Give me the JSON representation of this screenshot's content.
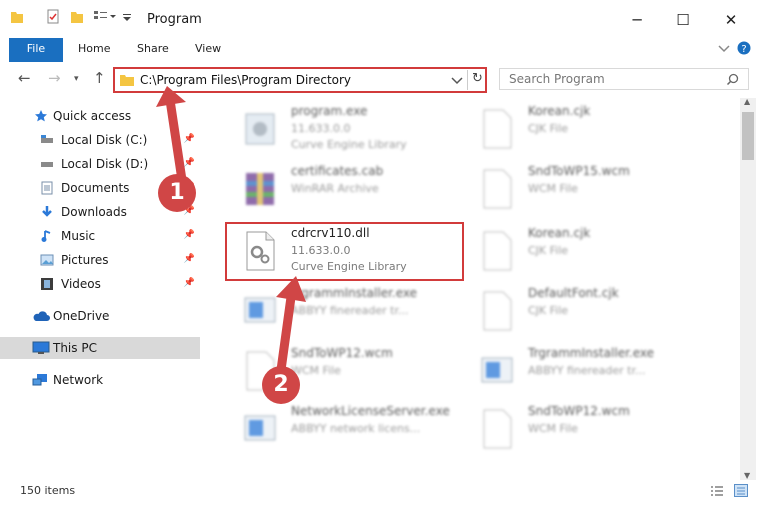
{
  "window": {
    "title": "Program"
  },
  "ribbon": {
    "tabs": [
      "File",
      "Home",
      "Share",
      "View"
    ]
  },
  "address": {
    "path": "C:\\Program Files\\Program Directory"
  },
  "search": {
    "placeholder": "Search Program"
  },
  "nav": {
    "items": [
      {
        "label": "Quick access",
        "icon": "star-icon",
        "pinned": false
      },
      {
        "label": "Local Disk (C:)",
        "icon": "drive-icon",
        "pinned": true
      },
      {
        "label": "Local Disk (D:)",
        "icon": "drive-icon",
        "pinned": true
      },
      {
        "label": "Documents",
        "icon": "document-icon",
        "pinned": true
      },
      {
        "label": "Downloads",
        "icon": "download-icon",
        "pinned": true
      },
      {
        "label": "Music",
        "icon": "music-icon",
        "pinned": true
      },
      {
        "label": "Pictures",
        "icon": "pictures-icon",
        "pinned": true
      },
      {
        "label": "Videos",
        "icon": "video-icon",
        "pinned": true
      },
      {
        "label": "OneDrive",
        "icon": "cloud-icon",
        "pinned": false
      },
      {
        "label": "This PC",
        "icon": "computer-icon",
        "pinned": false
      },
      {
        "label": "Network",
        "icon": "network-icon",
        "pinned": false
      }
    ]
  },
  "files": [
    {
      "name": "program.exe",
      "line2": "11.633.0.0",
      "line3": "Curve Engine Library"
    },
    {
      "name": "certificates.cab",
      "line2": "WinRAR Archive",
      "line3": ""
    },
    {
      "name": "cdrcrv110.dll",
      "line2": "11.633.0.0",
      "line3": "Curve Engine Library"
    },
    {
      "name": "TrgrammInstaller.exe",
      "line2": "ABBYY finereader tr...",
      "line3": ""
    },
    {
      "name": "SndToWP12.wcm",
      "line2": "WCM File",
      "line3": ""
    },
    {
      "name": "NetworkLicenseServer.exe",
      "line2": "ABBYY network licens...",
      "line3": ""
    },
    {
      "name": "Korean.cjk",
      "line2": "CJK File",
      "line3": ""
    },
    {
      "name": "SndToWP15.wcm",
      "line2": "WCM File",
      "line3": ""
    },
    {
      "name": "Korean.cjk",
      "line2": "CJK File",
      "line3": ""
    },
    {
      "name": "DefaultFont.cjk",
      "line2": "CJK File",
      "line3": ""
    },
    {
      "name": "TrgrammInstaller.exe",
      "line2": "ABBYY finereader tr...",
      "line3": ""
    },
    {
      "name": "SndToWP12.wcm",
      "line2": "WCM File",
      "line3": ""
    }
  ],
  "status": {
    "count": "150 items"
  },
  "annotations": {
    "step1": "1",
    "step2": "2"
  },
  "colors": {
    "accent": "#1a6fc0",
    "highlight": "#d23b3b",
    "badge": "#d04646"
  }
}
